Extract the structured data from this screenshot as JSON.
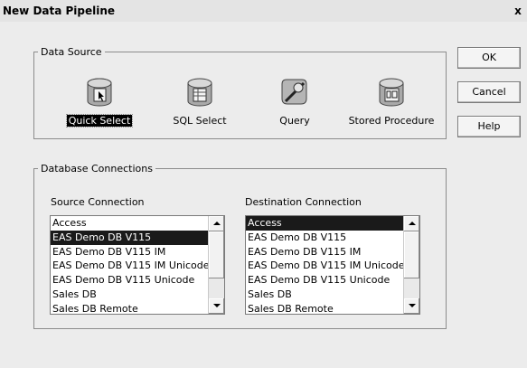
{
  "window": {
    "title": "New Data Pipeline",
    "close_label": "x"
  },
  "data_source": {
    "legend": "Data Source",
    "items": [
      {
        "label": "Quick Select",
        "icon": "quick-select-db-icon",
        "selected": true
      },
      {
        "label": "SQL Select",
        "icon": "sql-select-db-icon",
        "selected": false
      },
      {
        "label": "Query",
        "icon": "query-icon",
        "selected": false
      },
      {
        "label": "Stored Procedure",
        "icon": "stored-procedure-db-icon",
        "selected": false
      }
    ]
  },
  "buttons": {
    "ok": "OK",
    "cancel": "Cancel",
    "help": "Help"
  },
  "connections": {
    "legend": "Database Connections",
    "source": {
      "label": "Source Connection",
      "items": [
        "Access",
        "EAS Demo DB V115",
        "EAS Demo DB V115 IM",
        "EAS Demo DB V115 IM Unicode",
        "EAS Demo DB V115 Unicode",
        "Sales DB",
        "Sales DB Remote"
      ],
      "selected_index": 1
    },
    "destination": {
      "label": "Destination Connection",
      "items": [
        "Access",
        "EAS Demo DB V115",
        "EAS Demo DB V115 IM",
        "EAS Demo DB V115 IM Unicode",
        "EAS Demo DB V115 Unicode",
        "Sales DB",
        "Sales DB Remote"
      ],
      "selected_index": 0
    }
  }
}
